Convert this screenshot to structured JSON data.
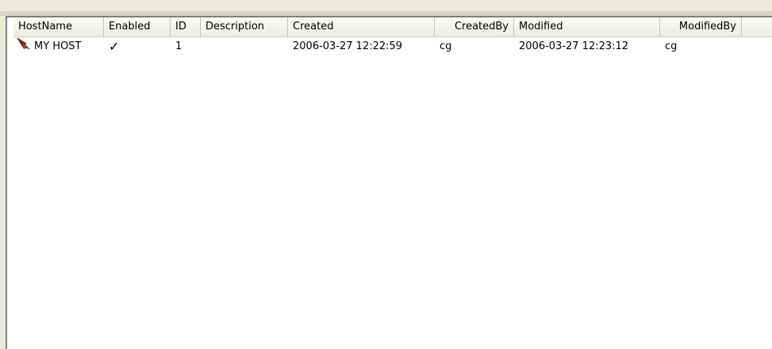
{
  "columns": {
    "hostname": "HostName",
    "enabled": "Enabled",
    "id": "ID",
    "description": "Description",
    "created": "Created",
    "createdby": "CreatedBy",
    "modified": "Modified",
    "modifiedby": "ModifiedBy"
  },
  "rows": [
    {
      "icon": "host-flag-icon",
      "hostname": "MY HOST",
      "enabled_mark": "✓",
      "id": "1",
      "description": "",
      "created": "2006-03-27 12:22:59",
      "createdby": "cg",
      "modified": "2006-03-27 12:23:12",
      "modifiedby": "cg"
    }
  ],
  "colors": {
    "background": "#ece9d8",
    "list_bg": "#ffffff",
    "border_dark": "#7f7f7f",
    "icon_red": "#cc1111"
  }
}
